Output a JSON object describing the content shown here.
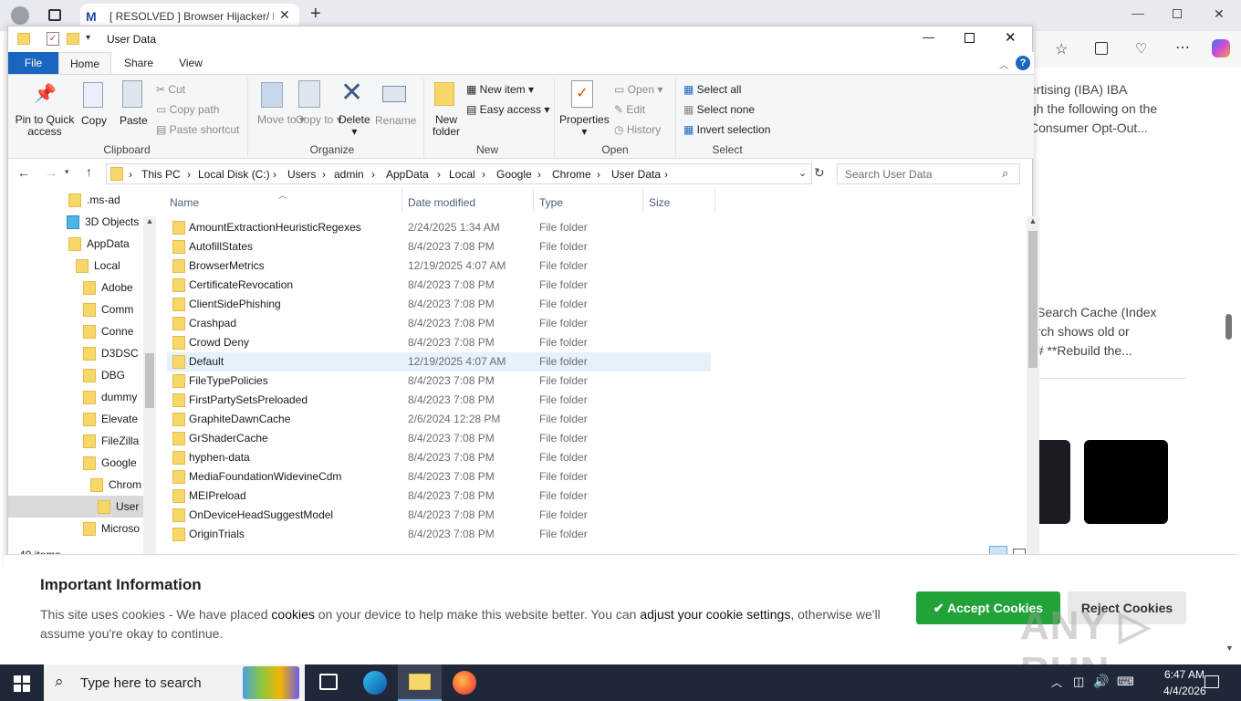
{
  "browser": {
    "tab_title": "[ RESOLVED ] Browser Hijacker/ Po",
    "page_snippets": [
      "ertising (IBA) IBA",
      "gh the following on the",
      "Consumer Opt-Out...",
      "Search Cache (Index",
      "arch shows old or",
      "## **Rebuild the..."
    ]
  },
  "explorer": {
    "title": "User Data",
    "tabs": {
      "file": "File",
      "home": "Home",
      "share": "Share",
      "view": "View"
    },
    "ribbon": {
      "pin": "Pin to Quick access",
      "copy": "Copy",
      "paste": "Paste",
      "cut": "Cut",
      "copy_path": "Copy path",
      "paste_shortcut": "Paste shortcut",
      "clipboard": "Clipboard",
      "move_to": "Move to",
      "copy_to": "Copy to",
      "delete": "Delete",
      "rename": "Rename",
      "organize": "Organize",
      "new_folder": "New folder",
      "new_item": "New item",
      "easy_access": "Easy access",
      "new": "New",
      "properties": "Properties",
      "open": "Open",
      "edit": "Edit",
      "history": "History",
      "open_group": "Open",
      "select_all": "Select all",
      "select_none": "Select none",
      "invert_selection": "Invert selection",
      "select": "Select"
    },
    "breadcrumb": [
      "This PC",
      "Local Disk (C:)",
      "Users",
      "admin",
      "AppData",
      "Local",
      "Google",
      "Chrome",
      "User Data"
    ],
    "search_placeholder": "Search User Data",
    "nav": [
      ".ms-ad",
      "3D Objects",
      "AppData",
      "Local",
      "Adobe",
      "Comm",
      "Conne",
      "D3DSC",
      "DBG",
      "dummy",
      "Elevate",
      "FileZilla",
      "Google",
      "Chrom",
      "User",
      "Microso"
    ],
    "columns": {
      "name": "Name",
      "date": "Date modified",
      "type": "Type",
      "size": "Size"
    },
    "files": [
      {
        "name": "AmountExtractionHeuristicRegexes",
        "date": "2/24/2025 1:34 AM",
        "type": "File folder"
      },
      {
        "name": "AutofillStates",
        "date": "8/4/2023 7:08 PM",
        "type": "File folder"
      },
      {
        "name": "BrowserMetrics",
        "date": "12/19/2025 4:07 AM",
        "type": "File folder"
      },
      {
        "name": "CertificateRevocation",
        "date": "8/4/2023 7:08 PM",
        "type": "File folder"
      },
      {
        "name": "ClientSidePhishing",
        "date": "8/4/2023 7:08 PM",
        "type": "File folder"
      },
      {
        "name": "Crashpad",
        "date": "8/4/2023 7:08 PM",
        "type": "File folder"
      },
      {
        "name": "Crowd Deny",
        "date": "8/4/2023 7:08 PM",
        "type": "File folder"
      },
      {
        "name": "Default",
        "date": "12/19/2025 4:07 AM",
        "type": "File folder"
      },
      {
        "name": "FileTypePolicies",
        "date": "8/4/2023 7:08 PM",
        "type": "File folder"
      },
      {
        "name": "FirstPartySetsPreloaded",
        "date": "8/4/2023 7:08 PM",
        "type": "File folder"
      },
      {
        "name": "GraphiteDawnCache",
        "date": "2/6/2024 12:28 PM",
        "type": "File folder"
      },
      {
        "name": "GrShaderCache",
        "date": "8/4/2023 7:08 PM",
        "type": "File folder"
      },
      {
        "name": "hyphen-data",
        "date": "8/4/2023 7:08 PM",
        "type": "File folder"
      },
      {
        "name": "MediaFoundationWidevineCdm",
        "date": "8/4/2023 7:08 PM",
        "type": "File folder"
      },
      {
        "name": "MEIPreload",
        "date": "8/4/2023 7:08 PM",
        "type": "File folder"
      },
      {
        "name": "OnDeviceHeadSuggestModel",
        "date": "8/4/2023 7:08 PM",
        "type": "File folder"
      },
      {
        "name": "OriginTrials",
        "date": "8/4/2023 7:08 PM",
        "type": "File folder"
      }
    ],
    "status": "40 items"
  },
  "cookie": {
    "title": "Important Information",
    "text_1": "This site uses cookies - We have placed ",
    "link_1": "cookies",
    "text_2": " on your device to help make this website better. You can ",
    "link_2": "adjust your cookie settings",
    "text_3": ", otherwise we'll",
    "text_4": "assume you're okay to continue.",
    "accept": "Accept Cookies",
    "reject": "Reject Cookies"
  },
  "taskbar": {
    "search": "Type here to search",
    "time": "6:47 AM",
    "date": "4/4/2026"
  },
  "watermark": "ANY RUN"
}
